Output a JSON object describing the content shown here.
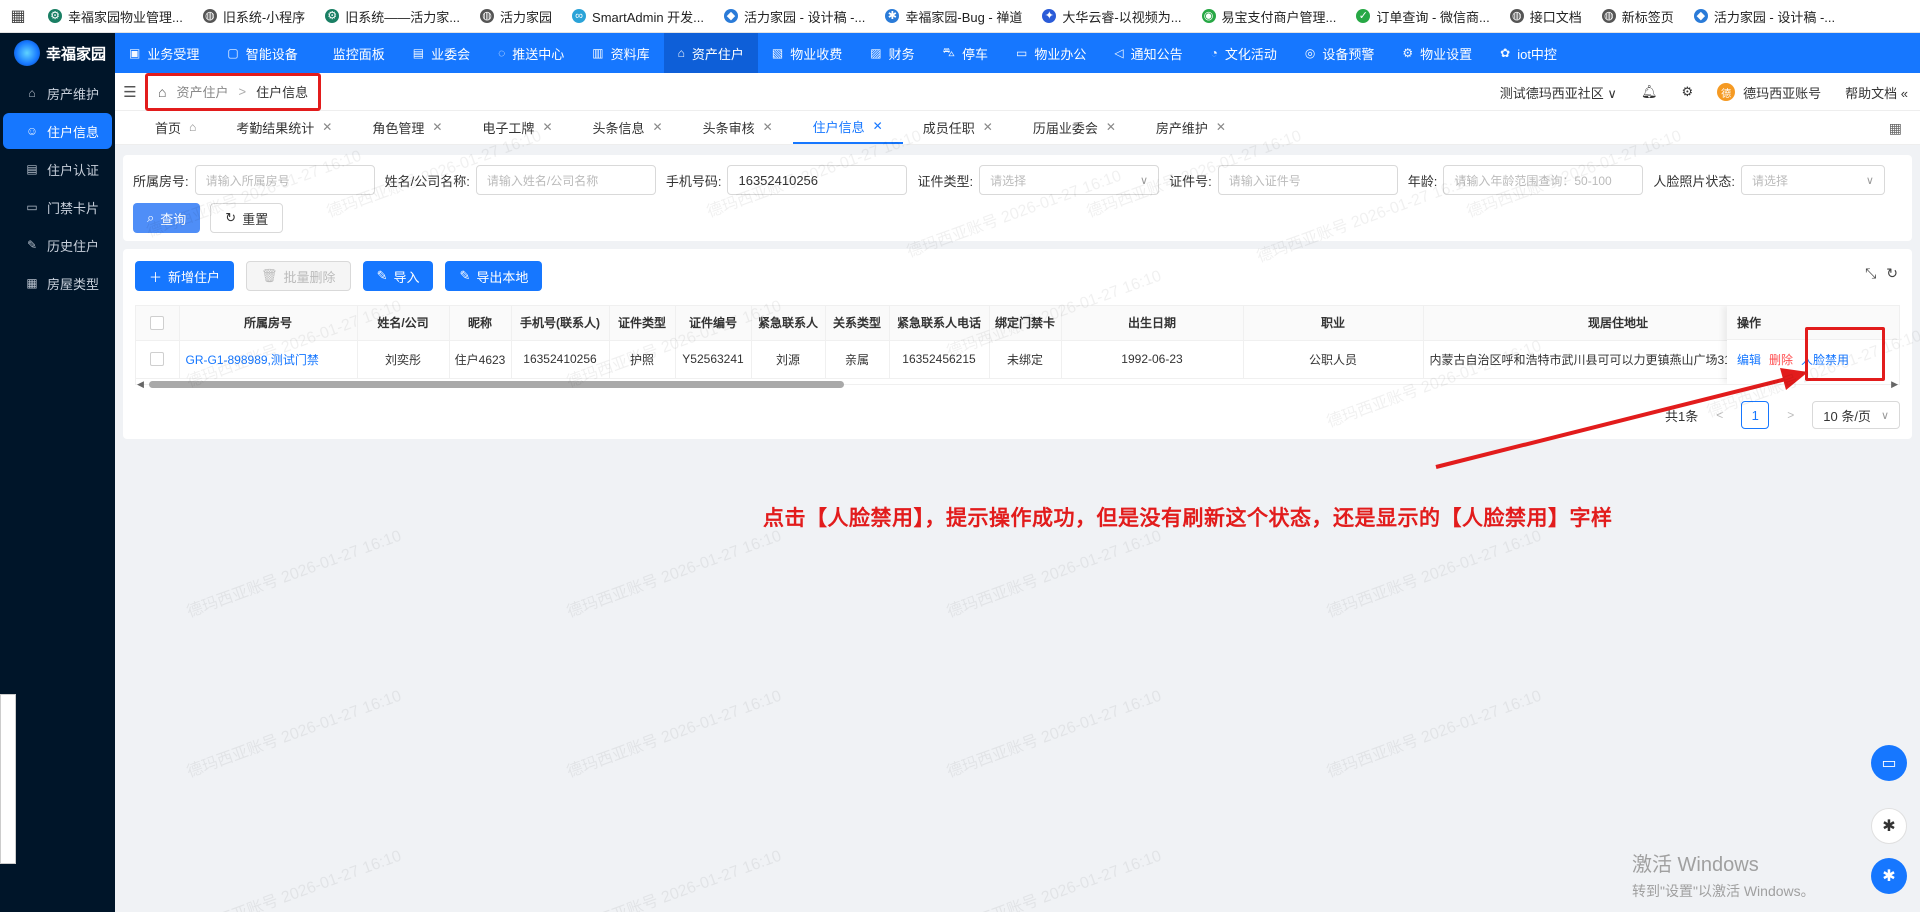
{
  "bookmarks": [
    {
      "label": "幸福家园物业管理...",
      "icon": "gear-icon",
      "color": "#1a7f64"
    },
    {
      "label": "旧系统-小程序",
      "icon": "globe-icon",
      "color": "#555555"
    },
    {
      "label": "旧系统——活力家...",
      "icon": "gear-icon",
      "color": "#1a7f64"
    },
    {
      "label": "活力家园",
      "icon": "globe-icon",
      "color": "#555555"
    },
    {
      "label": "SmartAdmin 开发...",
      "icon": "link-icon",
      "color": "#2aa3d8"
    },
    {
      "label": "活力家园 - 设计稿 -...",
      "icon": "design-icon",
      "color": "#2a7bd8"
    },
    {
      "label": "幸福家园-Bug - 禅道",
      "icon": "bug-icon",
      "color": "#2a7bd8"
    },
    {
      "label": "大华云睿-以视频为...",
      "icon": "camera-icon",
      "color": "#2a5bd8"
    },
    {
      "label": "易宝支付商户管理...",
      "icon": "pay-icon",
      "color": "#27a845"
    },
    {
      "label": "订单查询 - 微信商...",
      "icon": "check-icon",
      "color": "#27a845"
    },
    {
      "label": "接口文档",
      "icon": "globe-icon",
      "color": "#555555"
    },
    {
      "label": "新标签页",
      "icon": "globe-icon",
      "color": "#555555"
    },
    {
      "label": "活力家园 - 设计稿 -...",
      "icon": "design-icon",
      "color": "#2a7bd8"
    }
  ],
  "brand": {
    "name": "幸福家园"
  },
  "sidebar": {
    "items": [
      {
        "label": "房产维护",
        "icon": "home-icon"
      },
      {
        "label": "住户信息",
        "icon": "user-circle-icon",
        "active": true
      },
      {
        "label": "住户认证",
        "icon": "id-card-icon"
      },
      {
        "label": "门禁卡片",
        "icon": "card-icon"
      },
      {
        "label": "历史住户",
        "icon": "history-icon"
      },
      {
        "label": "房屋类型",
        "icon": "building-icon"
      }
    ]
  },
  "topnav": {
    "items": [
      {
        "label": "业务受理",
        "icon": "briefcase-icon"
      },
      {
        "label": "智能设备",
        "icon": "device-icon"
      },
      {
        "label": "监控面板",
        "icon": "monitor-icon"
      },
      {
        "label": "业委会",
        "icon": "doc-icon"
      },
      {
        "label": "推送中心",
        "icon": "chat-icon"
      },
      {
        "label": "资料库",
        "icon": "book-icon"
      },
      {
        "label": "资产住户",
        "icon": "home-icon",
        "active": true
      },
      {
        "label": "物业收费",
        "icon": "receipt-icon"
      },
      {
        "label": "财务",
        "icon": "finance-icon"
      },
      {
        "label": "停车",
        "icon": "car-icon"
      },
      {
        "label": "物业办公",
        "icon": "office-icon"
      },
      {
        "label": "通知公告",
        "icon": "megaphone-icon"
      },
      {
        "label": "文化活动",
        "icon": "activity-icon"
      },
      {
        "label": "设备预警",
        "icon": "alarm-icon"
      },
      {
        "label": "物业设置",
        "icon": "gear-icon"
      },
      {
        "label": "iot中控",
        "icon": "iot-icon"
      }
    ]
  },
  "header": {
    "breadcrumb_parent": "资产住户",
    "breadcrumb_sep": ">",
    "breadcrumb_current": "住户信息",
    "community": "测试德玛西亚社区",
    "account": "德玛西亚账号",
    "avatar_text": "德",
    "help": "帮助文档"
  },
  "tabs": [
    {
      "label": "首页",
      "closable": false,
      "home": true
    },
    {
      "label": "考勤结果统计",
      "closable": true
    },
    {
      "label": "角色管理",
      "closable": true
    },
    {
      "label": "电子工牌",
      "closable": true
    },
    {
      "label": "头条信息",
      "closable": true
    },
    {
      "label": "头条审核",
      "closable": true
    },
    {
      "label": "住户信息",
      "closable": true,
      "active": true
    },
    {
      "label": "成员任职",
      "closable": true
    },
    {
      "label": "历届业委会",
      "closable": true
    },
    {
      "label": "房产维护",
      "closable": true
    }
  ],
  "search": {
    "room_label": "所属房号:",
    "room_placeholder": "请输入所属房号",
    "name_label": "姓名/公司名称:",
    "name_placeholder": "请输入姓名/公司名称",
    "phone_label": "手机号码:",
    "phone_value": "16352410256",
    "idtype_label": "证件类型:",
    "idtype_placeholder": "请选择",
    "idno_label": "证件号:",
    "idno_placeholder": "请输入证件号",
    "age_label": "年龄:",
    "age_placeholder": "请输入年龄范围查询：50-100",
    "face_label": "人脸照片状态:",
    "face_placeholder": "请选择",
    "query_label": "查询",
    "reset_label": "重置"
  },
  "toolbar": {
    "add_label": "新增住户",
    "batch_delete_label": "批量删除",
    "import_label": "导入",
    "export_label": "导出本地"
  },
  "table": {
    "columns": [
      "所属房号",
      "姓名/公司",
      "昵称",
      "手机号(联系人)",
      "证件类型",
      "证件编号",
      "紧急联系人",
      "关系类型",
      "紧急联系人电话",
      "绑定门禁卡",
      "出生日期",
      "职业",
      "现居住地址"
    ],
    "ops_header": "操作",
    "rows": [
      {
        "cells": [
          "GR-G1-898989,测试门禁",
          "刘奕彤",
          "住户4623",
          "16352410256",
          "护照",
          "Y52563241",
          "刘源",
          "亲属",
          "16352456215",
          "未绑定",
          "1992-06-23",
          "公职人员",
          "内蒙古自治区呼和浩特市武川县可可以力更镇燕山广场31号楼"
        ],
        "ops": {
          "edit": "编辑",
          "delete": "删除",
          "face": "人脸禁用"
        }
      }
    ]
  },
  "pagination": {
    "total": "共1条",
    "current": "1",
    "page_size": "10 条/页"
  },
  "annotation": {
    "text": "点击【人脸禁用】，提示操作成功，但是没有刷新这个状态，还是显示的【人脸禁用】字样",
    "color": "#e21c1c"
  },
  "watermark": {
    "text": "德玛西亚账号 2026-01-27 16:10"
  },
  "windows": {
    "line1": "激活 Windows",
    "line2": "转到\"设置\"以激活 Windows。"
  },
  "colors": {
    "primary": "#1677ff",
    "sidebar_bg": "#001529",
    "danger": "#ff4d4f"
  }
}
